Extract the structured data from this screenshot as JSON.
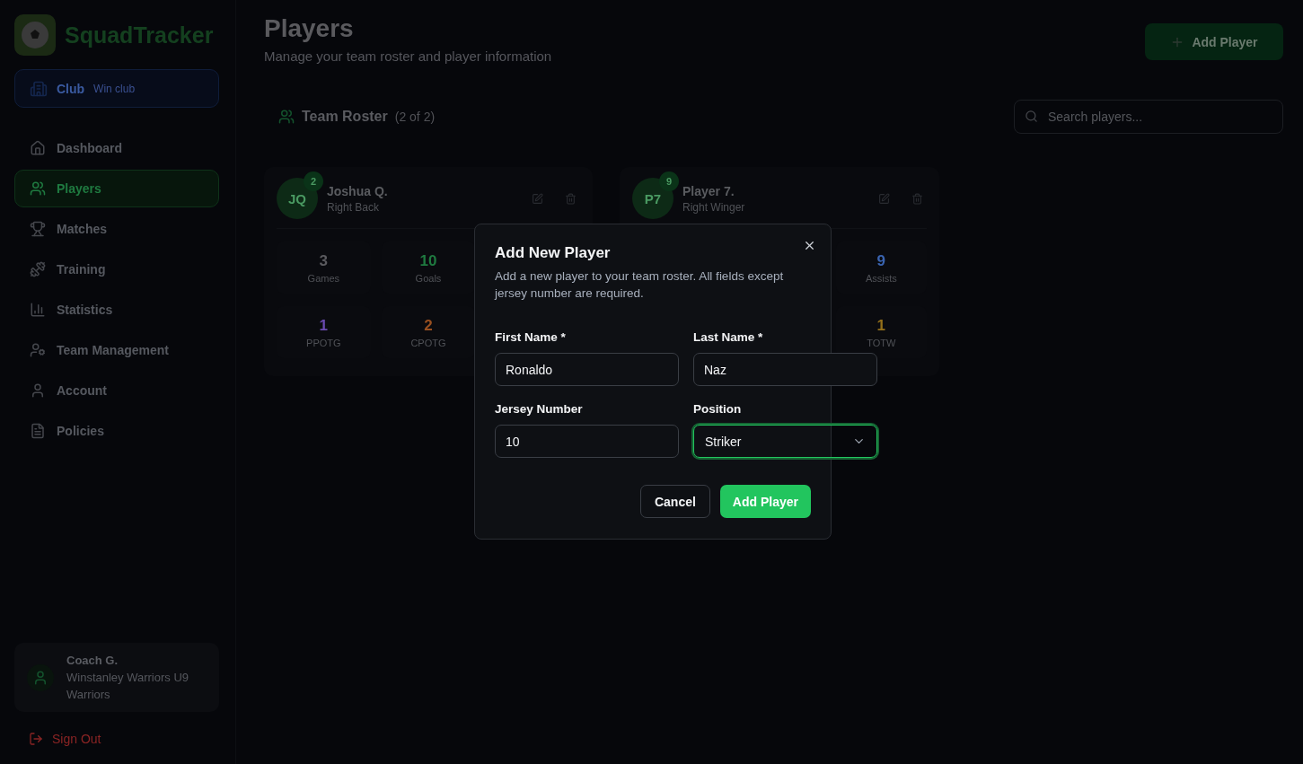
{
  "brand": {
    "name": "SquadTracker"
  },
  "club": {
    "label": "Club",
    "name": "Win club"
  },
  "nav": [
    {
      "label": "Dashboard",
      "selected": false
    },
    {
      "label": "Players",
      "selected": true
    },
    {
      "label": "Matches",
      "selected": false
    },
    {
      "label": "Training",
      "selected": false
    },
    {
      "label": "Statistics",
      "selected": false
    },
    {
      "label": "Team Management",
      "selected": false
    },
    {
      "label": "Account",
      "selected": false
    },
    {
      "label": "Policies",
      "selected": false
    }
  ],
  "user": {
    "name": "Coach G.",
    "team": "Winstanley Warriors U9 Warriors"
  },
  "sign_out": "Sign Out",
  "header": {
    "title": "Players",
    "subtitle": "Manage your team roster and player information",
    "add_button": "Add Player"
  },
  "roster": {
    "title": "Team Roster",
    "count": "(2 of 2)",
    "search_placeholder": "Search players..."
  },
  "players": [
    {
      "initials": "JQ",
      "number": "2",
      "name": "Joshua Q.",
      "position": "Right Back",
      "stats": [
        [
          {
            "value": "3",
            "label": "Games",
            "color": "#5a5a5e"
          },
          {
            "value": "10",
            "label": "Goals",
            "color": "#1f7a40"
          }
        ],
        [
          {
            "value": "1",
            "label": "PPOTG",
            "color": "#6a4ab0"
          },
          {
            "value": "2",
            "label": "CPOTG",
            "color": "#9a5020"
          }
        ]
      ]
    },
    {
      "initials": "P7",
      "number": "9",
      "name": "Player 7.",
      "position": "Right Winger",
      "stats": [
        [
          {
            "value": "9",
            "label": "Assists",
            "color": "#3a64b0"
          }
        ],
        [
          {
            "value": "1",
            "label": "TOTW",
            "color": "#94701a"
          }
        ]
      ]
    }
  ],
  "dialog": {
    "title": "Add New Player",
    "description": "Add a new player to your team roster. All fields except jersey number are required.",
    "fields": [
      {
        "kind": "text",
        "label": "First Name *",
        "value": "Ronaldo",
        "focused": false
      },
      {
        "kind": "text",
        "label": "Last Name *",
        "value": "Naz",
        "focused": false
      },
      {
        "kind": "text",
        "label": "Jersey Number",
        "value": "10",
        "focused": false
      },
      {
        "kind": "select",
        "label": "Position",
        "value": "Striker",
        "focused": true
      }
    ],
    "cancel": "Cancel",
    "submit": "Add Player"
  }
}
